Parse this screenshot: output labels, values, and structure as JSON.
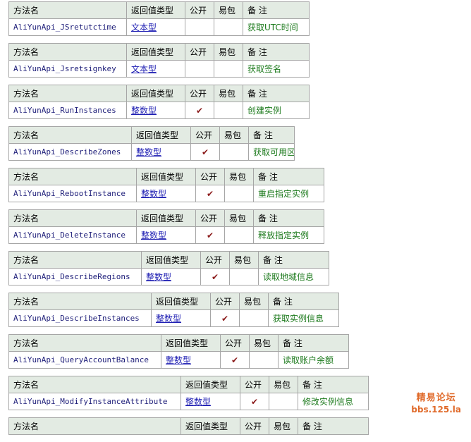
{
  "header": {
    "method": "方法名",
    "return_type": "返回值类型",
    "public": "公开",
    "easy_pack": "易包",
    "note": "备 注"
  },
  "methods": [
    {
      "name": "AliYunApi_JSretutctime",
      "return_type": "文本型",
      "public": false,
      "note": "获取UTC时间"
    },
    {
      "name": "AliYunApi_Jsretsignkey",
      "return_type": "文本型",
      "public": false,
      "note": "获取签名"
    },
    {
      "name": "AliYunApi_RunInstances",
      "return_type": "整数型",
      "public": true,
      "note": "创建实例"
    },
    {
      "name": "AliYunApi_DescribeZones",
      "return_type": "整数型",
      "public": true,
      "note": "获取可用区"
    },
    {
      "name": "AliYunApi_RebootInstance",
      "return_type": "整数型",
      "public": true,
      "note": "重启指定实例"
    },
    {
      "name": "AliYunApi_DeleteInstance",
      "return_type": "整数型",
      "public": true,
      "note": "释放指定实例"
    },
    {
      "name": "AliYunApi_DescribeRegions",
      "return_type": "整数型",
      "public": true,
      "note": "读取地域信息"
    },
    {
      "name": "AliYunApi_DescribeInstances",
      "return_type": "整数型",
      "public": true,
      "note": "获取实例信息"
    },
    {
      "name": "AliYunApi_QueryAccountBalance",
      "return_type": "整数型",
      "public": true,
      "note": "读取账户余额"
    },
    {
      "name": "AliYunApi_ModifyInstanceAttribute",
      "return_type": "整数型",
      "public": true,
      "note": "修改实例信息"
    }
  ],
  "check_mark": "✔",
  "watermark": {
    "line1": "精易论坛",
    "line2": "bbs.125.la"
  }
}
